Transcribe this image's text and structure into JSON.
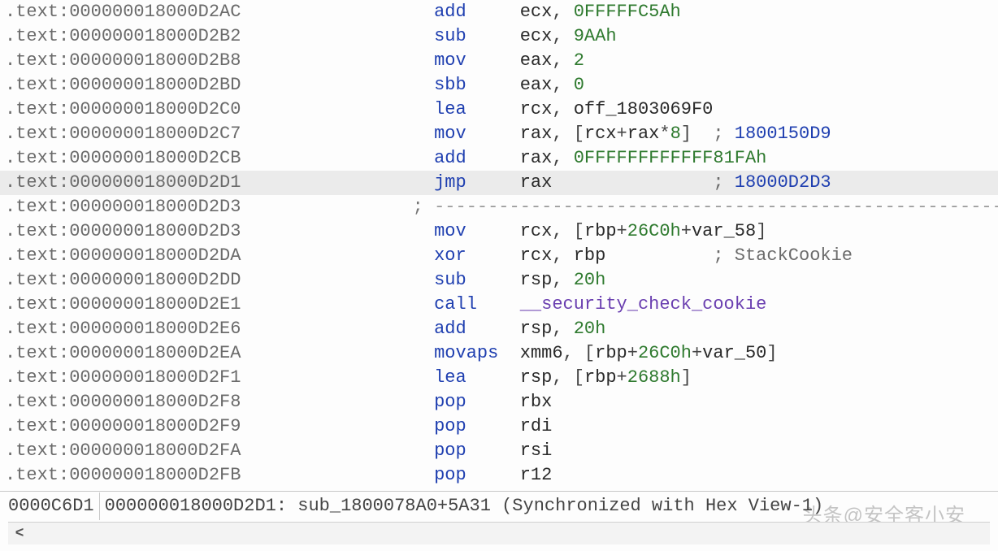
{
  "colors": {
    "highlight": "#ebebeb",
    "address": "#6b6b6b",
    "mnemonic": "#1f3fb0",
    "register": "#2a2a2a",
    "number": "#2f7a2f",
    "funcref": "#6a3fb0",
    "comment": "#6b6b6b"
  },
  "lines": [
    {
      "addr": ".text:000000018000D2AC",
      "mnem": "add",
      "ops": [
        {
          "t": "reg",
          "v": "ecx"
        },
        {
          "t": "punct",
          "v": ", "
        },
        {
          "t": "num",
          "v": "0FFFFFC5Ah"
        }
      ]
    },
    {
      "addr": ".text:000000018000D2B2",
      "mnem": "sub",
      "ops": [
        {
          "t": "reg",
          "v": "ecx"
        },
        {
          "t": "punct",
          "v": ", "
        },
        {
          "t": "num",
          "v": "9AAh"
        }
      ]
    },
    {
      "addr": ".text:000000018000D2B8",
      "mnem": "mov",
      "ops": [
        {
          "t": "reg",
          "v": "eax"
        },
        {
          "t": "punct",
          "v": ", "
        },
        {
          "t": "num",
          "v": "2"
        }
      ]
    },
    {
      "addr": ".text:000000018000D2BD",
      "mnem": "sbb",
      "ops": [
        {
          "t": "reg",
          "v": "eax"
        },
        {
          "t": "punct",
          "v": ", "
        },
        {
          "t": "num",
          "v": "0"
        }
      ]
    },
    {
      "addr": ".text:000000018000D2C0",
      "mnem": "lea",
      "ops": [
        {
          "t": "reg",
          "v": "rcx"
        },
        {
          "t": "punct",
          "v": ", "
        },
        {
          "t": "reg",
          "v": "off_1803069F0"
        }
      ]
    },
    {
      "addr": ".text:000000018000D2C7",
      "mnem": "mov",
      "ops": [
        {
          "t": "reg",
          "v": "rax"
        },
        {
          "t": "punct",
          "v": ", ["
        },
        {
          "t": "reg",
          "v": "rcx"
        },
        {
          "t": "punct",
          "v": "+"
        },
        {
          "t": "reg",
          "v": "rax"
        },
        {
          "t": "punct",
          "v": "*"
        },
        {
          "t": "num",
          "v": "8"
        },
        {
          "t": "punct",
          "v": "]"
        }
      ],
      "comment": "1800150D9",
      "comment_style": "cmtnum"
    },
    {
      "addr": ".text:000000018000D2CB",
      "mnem": "add",
      "ops": [
        {
          "t": "reg",
          "v": "rax"
        },
        {
          "t": "punct",
          "v": ", "
        },
        {
          "t": "num",
          "v": "0FFFFFFFFFFFF81FAh"
        }
      ]
    },
    {
      "addr": ".text:000000018000D2D1",
      "mnem": "jmp",
      "ops": [
        {
          "t": "reg",
          "v": "rax"
        }
      ],
      "comment": "18000D2D3",
      "comment_style": "cmtnum",
      "hl": true
    },
    {
      "addr": ".text:000000018000D2D3",
      "sep": true,
      "sep_prefix": " ; "
    },
    {
      "addr": ".text:000000018000D2D3",
      "mnem": "mov",
      "ops": [
        {
          "t": "reg",
          "v": "rcx"
        },
        {
          "t": "punct",
          "v": ", ["
        },
        {
          "t": "reg",
          "v": "rbp"
        },
        {
          "t": "punct",
          "v": "+"
        },
        {
          "t": "num",
          "v": "26C0h"
        },
        {
          "t": "punct",
          "v": "+"
        },
        {
          "t": "reg",
          "v": "var_58"
        },
        {
          "t": "punct",
          "v": "]"
        }
      ]
    },
    {
      "addr": ".text:000000018000D2DA",
      "mnem": "xor",
      "ops": [
        {
          "t": "reg",
          "v": "rcx"
        },
        {
          "t": "punct",
          "v": ", "
        },
        {
          "t": "reg",
          "v": "rbp"
        }
      ],
      "comment": "StackCookie",
      "comment_style": "cmt"
    },
    {
      "addr": ".text:000000018000D2DD",
      "mnem": "sub",
      "ops": [
        {
          "t": "reg",
          "v": "rsp"
        },
        {
          "t": "punct",
          "v": ", "
        },
        {
          "t": "num",
          "v": "20h"
        }
      ]
    },
    {
      "addr": ".text:000000018000D2E1",
      "mnem": "call",
      "ops": [
        {
          "t": "funcref",
          "v": "__security_check_cookie"
        }
      ]
    },
    {
      "addr": ".text:000000018000D2E6",
      "mnem": "add",
      "ops": [
        {
          "t": "reg",
          "v": "rsp"
        },
        {
          "t": "punct",
          "v": ", "
        },
        {
          "t": "num",
          "v": "20h"
        }
      ]
    },
    {
      "addr": ".text:000000018000D2EA",
      "mnem": "movaps",
      "ops": [
        {
          "t": "reg",
          "v": "xmm6"
        },
        {
          "t": "punct",
          "v": ", ["
        },
        {
          "t": "reg",
          "v": "rbp"
        },
        {
          "t": "punct",
          "v": "+"
        },
        {
          "t": "num",
          "v": "26C0h"
        },
        {
          "t": "punct",
          "v": "+"
        },
        {
          "t": "reg",
          "v": "var_50"
        },
        {
          "t": "punct",
          "v": "]"
        }
      ]
    },
    {
      "addr": ".text:000000018000D2F1",
      "mnem": "lea",
      "ops": [
        {
          "t": "reg",
          "v": "rsp"
        },
        {
          "t": "punct",
          "v": ", ["
        },
        {
          "t": "reg",
          "v": "rbp"
        },
        {
          "t": "punct",
          "v": "+"
        },
        {
          "t": "num",
          "v": "2688h"
        },
        {
          "t": "punct",
          "v": "]"
        }
      ]
    },
    {
      "addr": ".text:000000018000D2F8",
      "mnem": "pop",
      "ops": [
        {
          "t": "reg",
          "v": "rbx"
        }
      ]
    },
    {
      "addr": ".text:000000018000D2F9",
      "mnem": "pop",
      "ops": [
        {
          "t": "reg",
          "v": "rdi"
        }
      ]
    },
    {
      "addr": ".text:000000018000D2FA",
      "mnem": "pop",
      "ops": [
        {
          "t": "reg",
          "v": "rsi"
        }
      ]
    },
    {
      "addr": ".text:000000018000D2FB",
      "mnem": "pop",
      "ops": [
        {
          "t": "reg",
          "v": "r12"
        }
      ]
    }
  ],
  "layout": {
    "mnem_col": 40,
    "ops_col": 48,
    "comment_col": 66
  },
  "status": {
    "offset": "0000C6D1",
    "where": "000000018000D2D1: sub_1800078A0+5A31 (Synchronized with Hex View-1)"
  },
  "watermark": "头条@安全客小安",
  "scroll_left_glyph": "<"
}
